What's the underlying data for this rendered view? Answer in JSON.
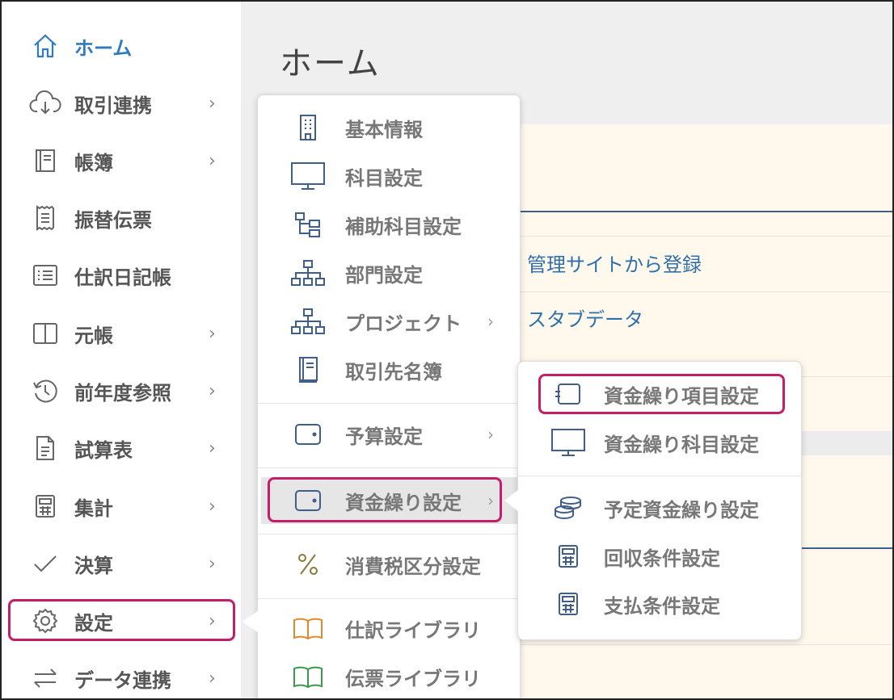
{
  "sidebar": {
    "items": [
      {
        "label": "ホーム",
        "icon": "home-icon",
        "chevron": ""
      },
      {
        "label": "取引連携",
        "icon": "cloud-download-icon",
        "chevron": "›"
      },
      {
        "label": "帳簿",
        "icon": "book-icon",
        "chevron": "›"
      },
      {
        "label": "振替伝票",
        "icon": "receipt-icon",
        "chevron": ""
      },
      {
        "label": "仕訳日記帳",
        "icon": "list-icon",
        "chevron": ""
      },
      {
        "label": "元帳",
        "icon": "columns-icon",
        "chevron": "›"
      },
      {
        "label": "前年度参照",
        "icon": "history-icon",
        "chevron": "›"
      },
      {
        "label": "試算表",
        "icon": "document-icon",
        "chevron": "›"
      },
      {
        "label": "集計",
        "icon": "calculator-icon",
        "chevron": "›"
      },
      {
        "label": "決算",
        "icon": "check-icon",
        "chevron": "›"
      },
      {
        "label": "設定",
        "icon": "gear-icon",
        "chevron": "›"
      },
      {
        "label": "データ連携",
        "icon": "swap-icon",
        "chevron": "›"
      }
    ]
  },
  "main": {
    "title": "ホーム",
    "links": [
      "管理サイトから登録",
      "スタブデータ"
    ]
  },
  "settings_menu": {
    "items": [
      {
        "label": "基本情報",
        "icon": "building-icon",
        "chevron": ""
      },
      {
        "label": "科目設定",
        "icon": "monitor-icon",
        "chevron": ""
      },
      {
        "label": "補助科目設定",
        "icon": "tree-icon",
        "chevron": ""
      },
      {
        "label": "部門設定",
        "icon": "org-chart-icon",
        "chevron": ""
      },
      {
        "label": "プロジェクト",
        "icon": "org-chart-icon",
        "chevron": "›"
      },
      {
        "label": "取引先名簿",
        "icon": "address-book-icon",
        "chevron": ""
      },
      {
        "label": "予算設定",
        "icon": "wallet-icon",
        "chevron": "›"
      },
      {
        "label": "資金繰り設定",
        "icon": "wallet-icon",
        "chevron": "›"
      },
      {
        "label": "消費税区分設定",
        "icon": "percent-icon",
        "chevron": ""
      },
      {
        "label": "仕訳ライブラリ",
        "icon": "open-book-orange-icon",
        "chevron": ""
      },
      {
        "label": "伝票ライブラリ",
        "icon": "open-book-green-icon",
        "chevron": ""
      }
    ]
  },
  "cashflow_menu": {
    "items": [
      {
        "label": "資金繰り項目設定",
        "icon": "tag-icon"
      },
      {
        "label": "資金繰り科目設定",
        "icon": "monitor-icon"
      },
      {
        "label": "予定資金繰り設定",
        "icon": "coins-icon"
      },
      {
        "label": "回収条件設定",
        "icon": "calculator-icon"
      },
      {
        "label": "支払条件設定",
        "icon": "calculator-icon"
      }
    ]
  },
  "colors": {
    "accent": "#2f7bbf",
    "highlight": "#c41e68",
    "icon": "#3f5f8a"
  }
}
